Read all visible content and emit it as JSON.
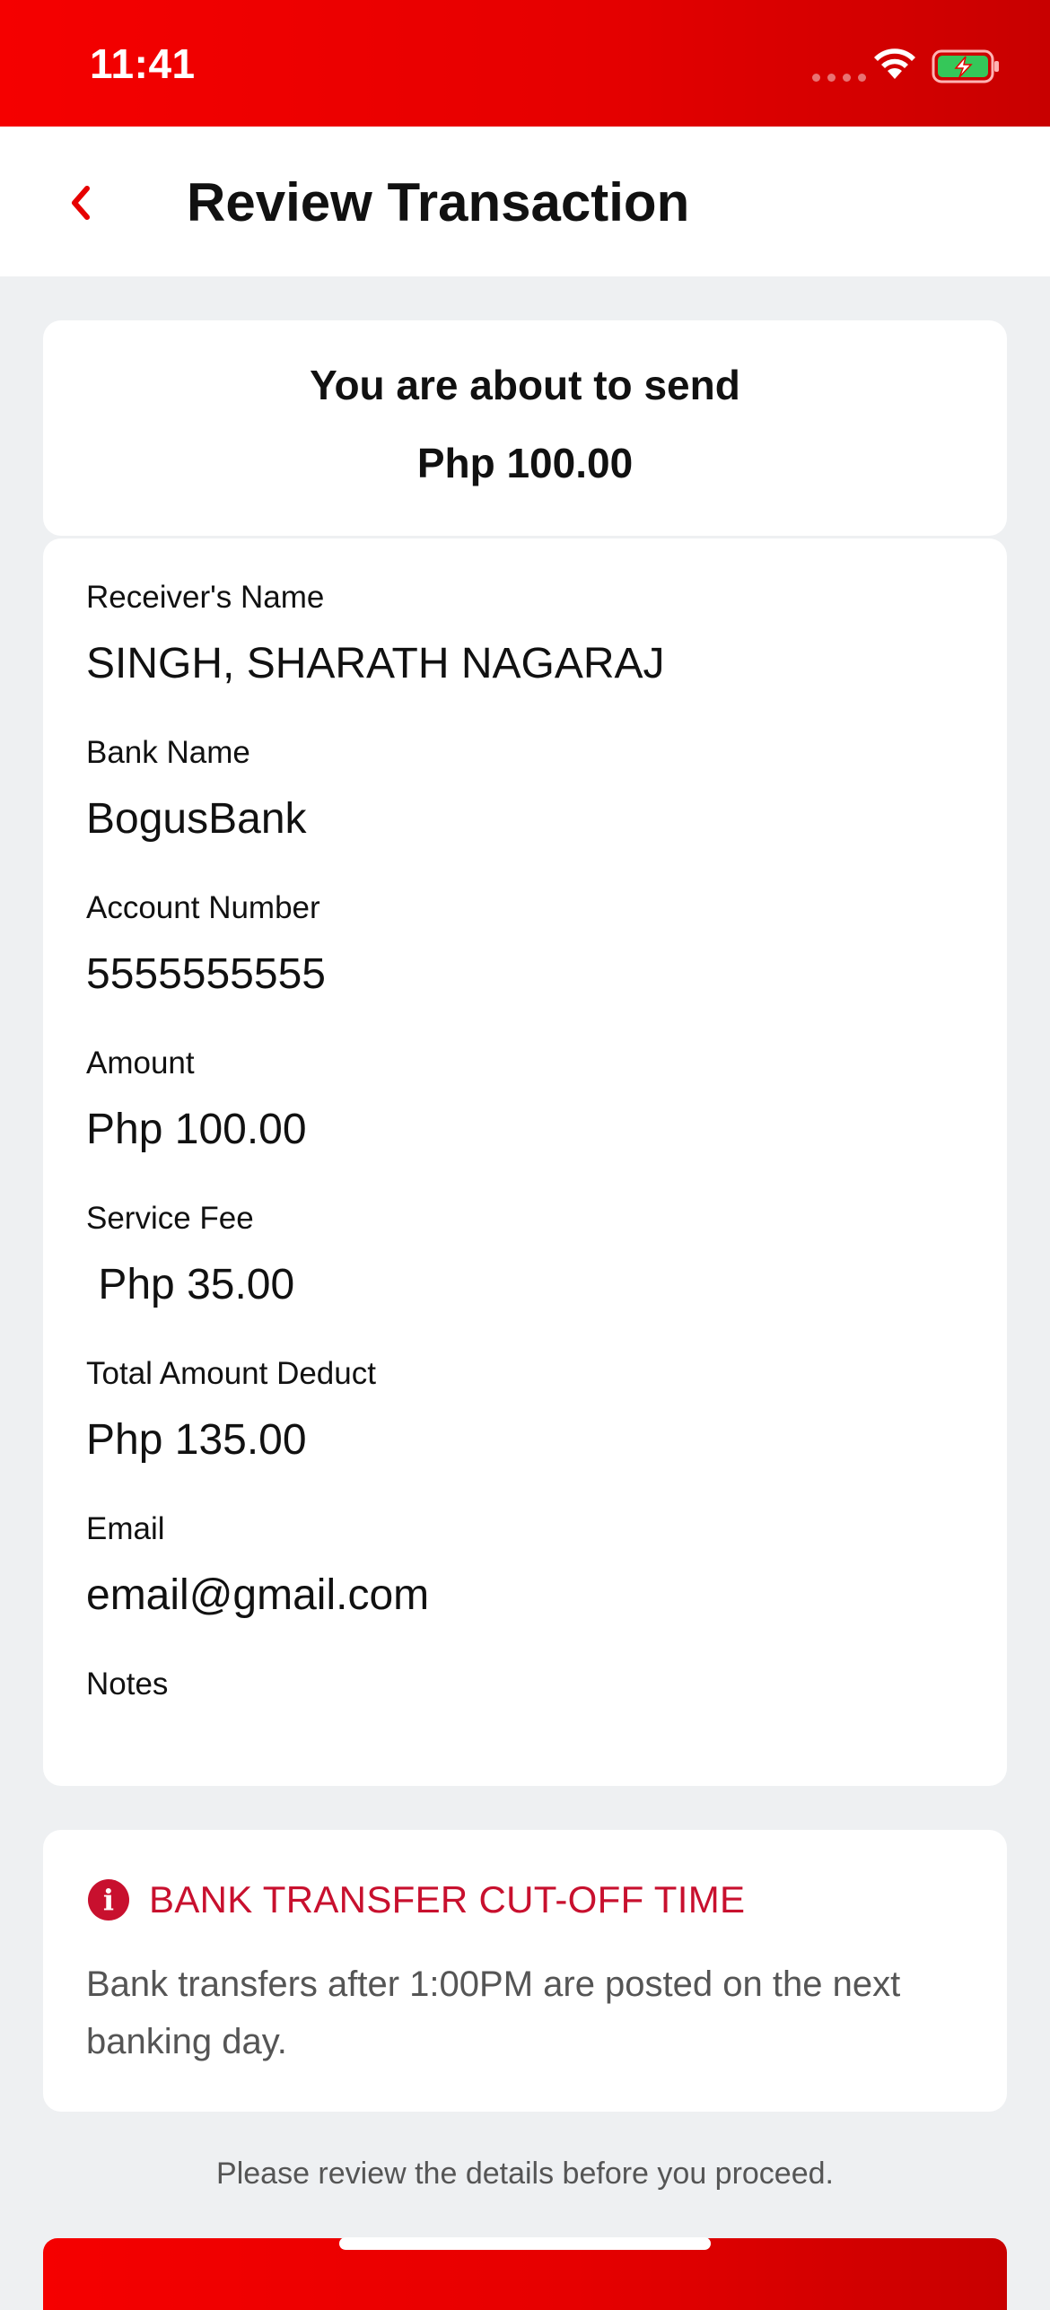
{
  "status_bar": {
    "time": "11:41"
  },
  "header": {
    "title": "Review Transaction",
    "back_icon": "chevron-left-icon"
  },
  "summary": {
    "line1": "You are about to send",
    "amount": "Php 100.00"
  },
  "details": [
    {
      "label": "Receiver's Name",
      "value": "SINGH, SHARATH NAGARAJ"
    },
    {
      "label": "Bank Name",
      "value": "BogusBank"
    },
    {
      "label": "Account Number",
      "value": "5555555555"
    },
    {
      "label": "Amount",
      "value": "Php 100.00"
    },
    {
      "label": "Service Fee",
      "value": " Php 35.00"
    },
    {
      "label": "Total Amount Deduct",
      "value": "Php 135.00"
    },
    {
      "label": "Email",
      "value": "email@gmail.com"
    },
    {
      "label": "Notes",
      "value": ""
    }
  ],
  "notice": {
    "icon": "info-icon",
    "title": "BANK TRANSFER CUT-OFF TIME",
    "body": "Bank transfers after 1:00PM are posted on the next banking day."
  },
  "footer": {
    "review_text": "Please review the details before you proceed."
  },
  "colors": {
    "brand_red": "#e60000",
    "notice_red": "#c8102e"
  }
}
